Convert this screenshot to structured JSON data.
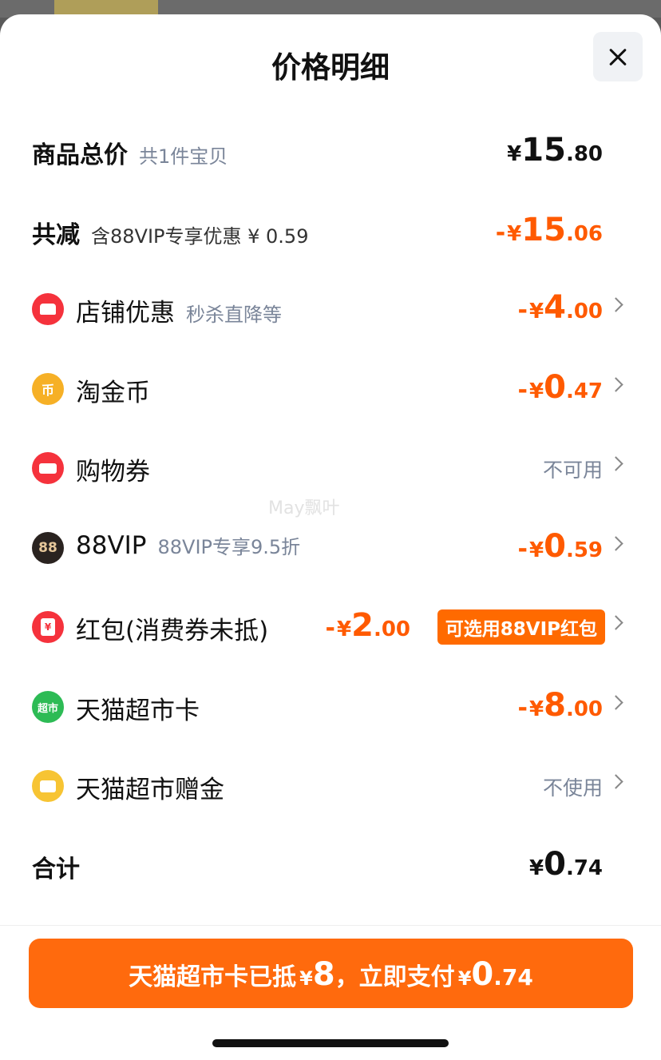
{
  "header": {
    "title": "价格明细"
  },
  "summary": {
    "subtotal": {
      "label": "商品总价",
      "note": "共1件宝贝",
      "currency": "¥",
      "int": "15",
      "dec": ".80"
    },
    "discount_total": {
      "label": "共减",
      "note": "含88VIP专享优惠 ¥ 0.59",
      "sign": "-",
      "currency": "¥",
      "int": "15",
      "dec": ".06"
    }
  },
  "items": [
    {
      "label": "店铺优惠",
      "note": "秒杀直降等",
      "sign": "-",
      "currency": "¥",
      "int": "4",
      "dec": ".00",
      "icon": "store-icon",
      "color": "#f5323c"
    },
    {
      "label": "淘金币",
      "note": "",
      "sign": "-",
      "currency": "¥",
      "int": "0",
      "dec": ".47",
      "icon": "coin-icon",
      "color": "#f6b026",
      "glyph": "币"
    },
    {
      "label": "购物券",
      "note": "",
      "status": "不可用",
      "icon": "ticket-icon",
      "color": "#f5323c"
    },
    {
      "label": "88VIP",
      "note": "88VIP专享9.5折",
      "sign": "-",
      "currency": "¥",
      "int": "0",
      "dec": ".59",
      "icon": "vip-88-icon",
      "color": "#2a2320",
      "glyph": "88"
    },
    {
      "label": "红包(消费券未抵)",
      "note": "",
      "sign": "-",
      "currency": "¥",
      "int": "2",
      "dec": ".00",
      "badge": "可选用88VIP红包",
      "icon": "red-packet-icon",
      "color": "#f5323c",
      "glyph": "¥"
    },
    {
      "label": "天猫超市卡",
      "note": "",
      "sign": "-",
      "currency": "¥",
      "int": "8",
      "dec": ".00",
      "icon": "tmall-supermarket-icon",
      "color": "#2dbb55",
      "glyph": "超市"
    },
    {
      "label": "天猫超市赠金",
      "note": "",
      "status": "不使用",
      "icon": "gift-money-icon",
      "color": "#f7c433"
    }
  ],
  "total": {
    "label": "合计",
    "currency": "¥",
    "int": "0",
    "dec": ".74"
  },
  "watermark": "May飘叶",
  "pay_button": {
    "prefix": "天猫超市卡已抵",
    "deduct_currency": "¥",
    "deduct_amount": "8",
    "middle": "，立即支付",
    "currency": "¥",
    "int": "0",
    "dec": ".74"
  }
}
